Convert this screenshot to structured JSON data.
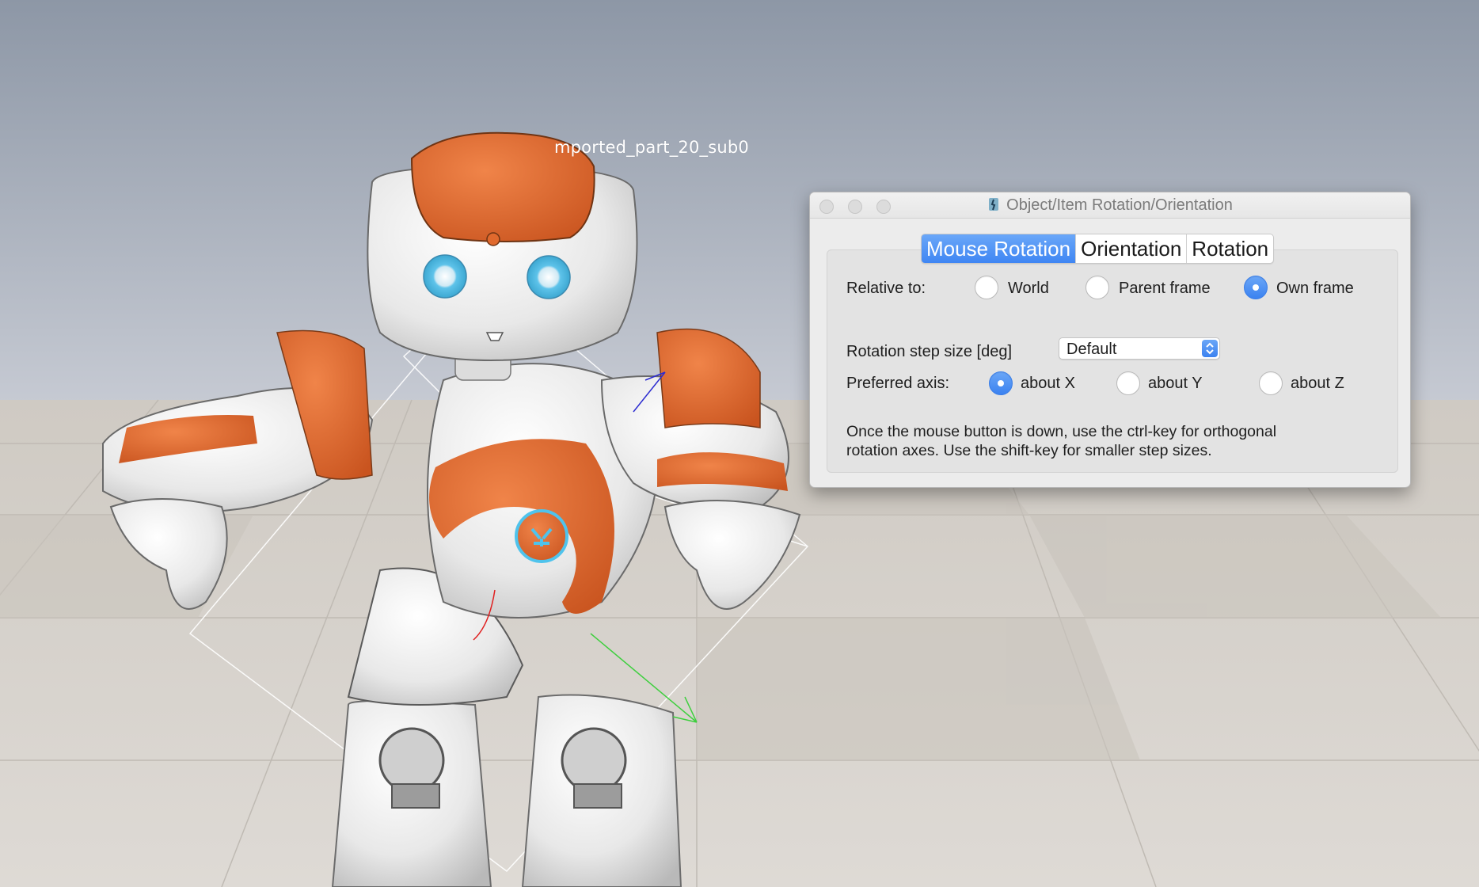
{
  "scene": {
    "object_label": "mported_part_20_sub0"
  },
  "dialog": {
    "title": "Object/Item Rotation/Orientation",
    "tabs": [
      {
        "label": "Mouse Rotation",
        "active": true
      },
      {
        "label": "Orientation",
        "active": false
      },
      {
        "label": "Rotation",
        "active": false
      }
    ],
    "relative_to": {
      "label": "Relative to:",
      "options": [
        {
          "label": "World",
          "checked": false
        },
        {
          "label": "Parent frame",
          "checked": false
        },
        {
          "label": "Own frame",
          "checked": true
        }
      ]
    },
    "step_size": {
      "label": "Rotation step size [deg]",
      "value": "Default"
    },
    "preferred_axis": {
      "label": "Preferred axis:",
      "options": [
        {
          "label": "about X",
          "checked": true
        },
        {
          "label": "about Y",
          "checked": false
        },
        {
          "label": "about Z",
          "checked": false
        }
      ]
    },
    "hint_line1": "Once the mouse button is down, use the ctrl-key for orthogonal",
    "hint_line2": "rotation axes. Use the shift-key for smaller step sizes."
  },
  "colors": {
    "accent": "#3f86f3",
    "robot_orange": "#e8652a",
    "robot_eye": "#5ec3ea",
    "sky_top": "#8d97a6",
    "floor": "#d7d3cd"
  }
}
